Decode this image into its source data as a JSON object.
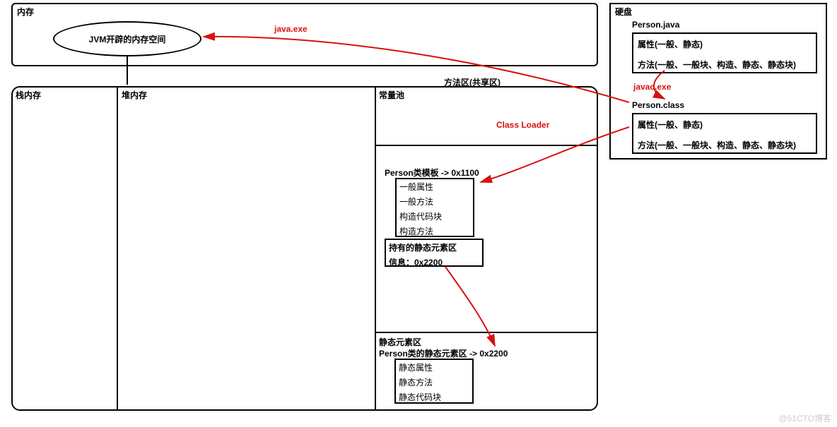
{
  "memory": {
    "title": "内存",
    "jvm_space": "JVM开辟的内存空间",
    "stack": "栈内存",
    "heap": "堆内存",
    "method_area": "方法区(共享区)",
    "constant_pool": "常量池",
    "template_header": "Person类模板 -> 0x1100",
    "template_rows": {
      "r1": "一般属性",
      "r2": "一般方法",
      "r3": "构造代码块",
      "r4": "构造方法"
    },
    "static_hold_header": "持有的静态元素区",
    "static_hold_info": "信息：0x2200",
    "static_area_title": "静态元素区",
    "static_person_header": "Person类的静态元素区 -> 0x2200",
    "static_rows": {
      "r1": "静态属性",
      "r2": "静态方法",
      "r3": "静态代码块"
    }
  },
  "disk": {
    "title": "硬盘",
    "person_java": "Person.java",
    "java_box1": "属性(一般、静态)",
    "java_box2": "方法(一般、一般块、构造、静态、静态块)",
    "person_class": "Person.class",
    "class_box1": "属性(一般、静态)",
    "class_box2": "方法(一般、一般块、构造、静态、静态块)"
  },
  "labels": {
    "java_exe": "java.exe",
    "javac_exe": "javac.exe",
    "class_loader": "Class Loader"
  },
  "watermark": "@51CTO博客"
}
